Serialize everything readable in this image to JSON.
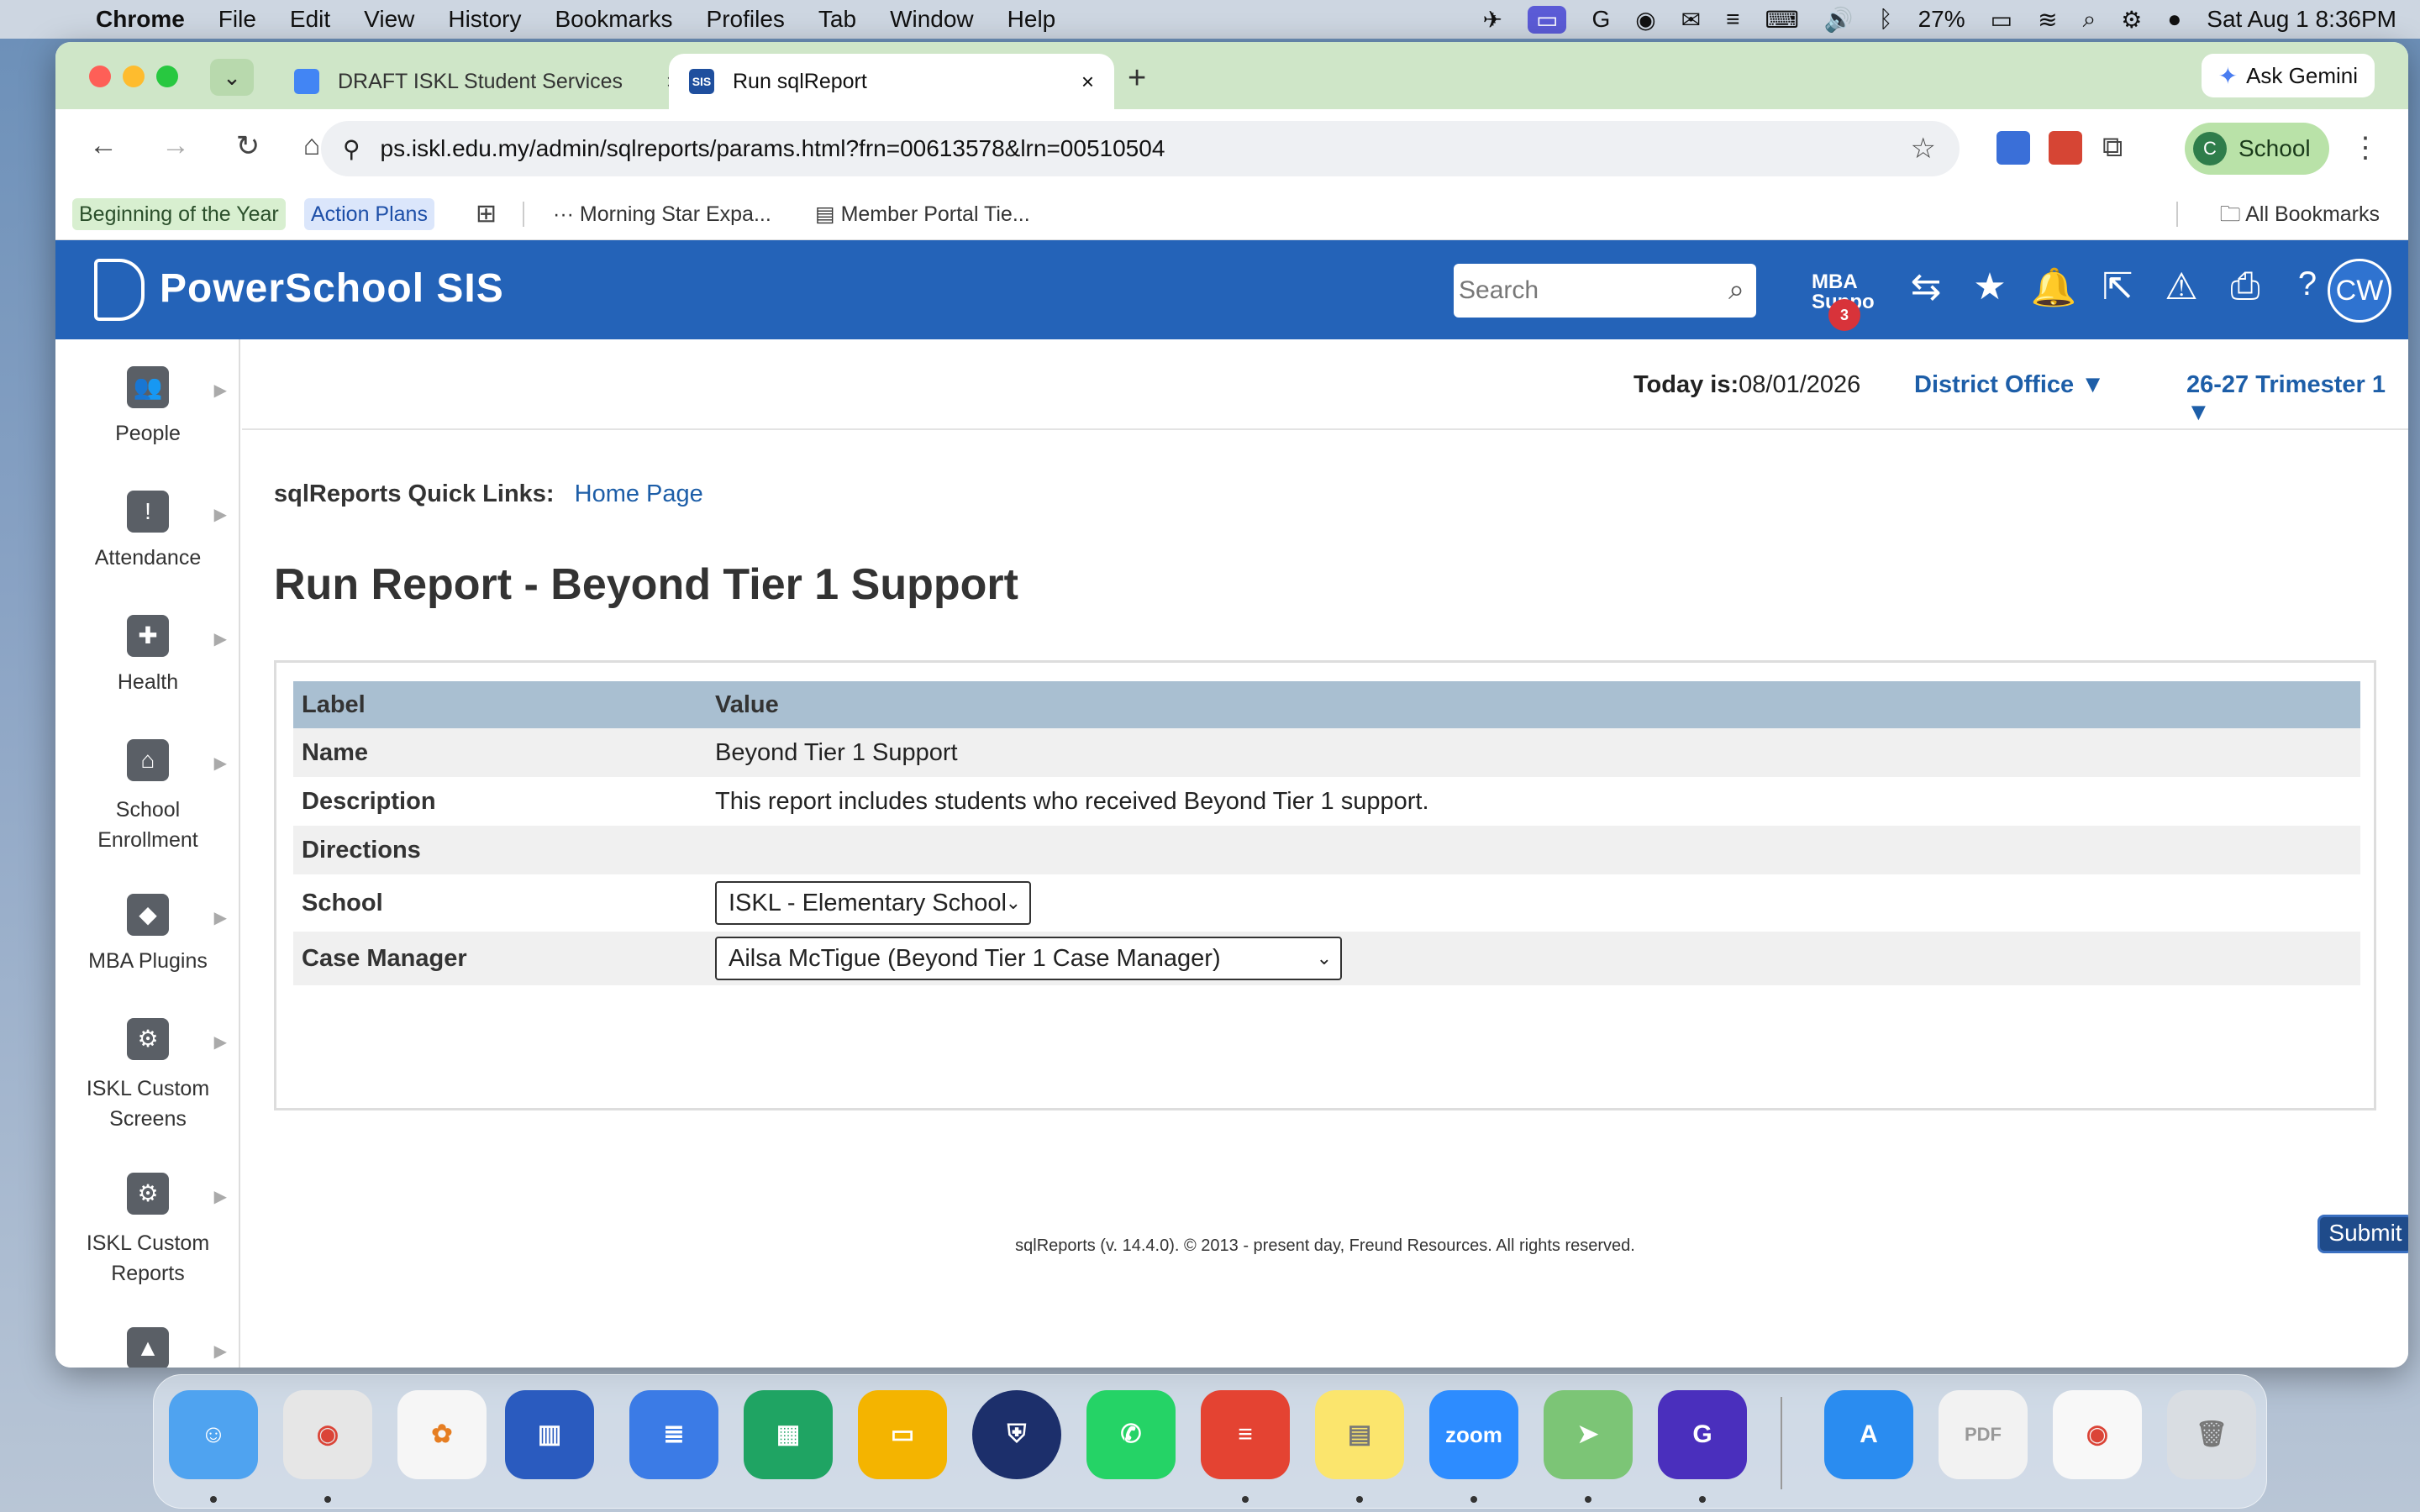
{
  "menubar": {
    "app_name": "Chrome",
    "items": [
      "File",
      "Edit",
      "View",
      "History",
      "Bookmarks",
      "Profiles",
      "Tab",
      "Window",
      "Help"
    ],
    "battery": "27%",
    "datetime": "Sat Aug 1  8:36PM"
  },
  "browser": {
    "tabs": [
      {
        "title": "DRAFT ISKL Student Services",
        "active": false
      },
      {
        "title": "Run sqlReport",
        "active": true
      }
    ],
    "ask_gemini": "Ask Gemini",
    "url": "ps.iskl.edu.my/admin/sqlreports/params.html?frn=00613578&lrn=00510504",
    "profile": "School",
    "profile_initial": "C",
    "bookmarks": [
      "Beginning of the Year",
      "Action Plans",
      "Morning Star Expa...",
      "Member Portal Tie..."
    ],
    "all_bookmarks": "All Bookmarks"
  },
  "ps": {
    "brand": "PowerSchool SIS",
    "search_placeholder": "Search",
    "mba_label": "MBA",
    "mba_sub": "Suppo",
    "mba_count": "3",
    "avatar": "CW",
    "today_label": "Today is:",
    "today_value": "08/01/2026",
    "school_menu": "District Office",
    "term_menu": "26-27 Trimester 1",
    "sidebar": [
      {
        "label": "People",
        "icon": "people-icon"
      },
      {
        "label": "Attendance",
        "icon": "attendance-icon"
      },
      {
        "label": "Health",
        "icon": "health-icon"
      },
      {
        "label": "School Enrollment",
        "icon": "school-enrollment-icon"
      },
      {
        "label": "MBA Plugins",
        "icon": "mba-plugins-icon"
      },
      {
        "label": "ISKL Custom Screens",
        "icon": "custom-screens-icon"
      },
      {
        "label": "ISKL Custom Reports",
        "icon": "custom-reports-icon"
      }
    ]
  },
  "page": {
    "quick_links_label": "sqlReports Quick Links:",
    "home_link": "Home Page",
    "title": "Run Report - Beyond Tier 1 Support",
    "table_header": {
      "label": "Label",
      "value": "Value"
    },
    "rows": {
      "name_label": "Name",
      "name_value": "Beyond Tier 1 Support",
      "description_label": "Description",
      "description_value": "This report includes students who received Beyond Tier 1 support.",
      "directions_label": "Directions",
      "school_label": "School",
      "school_value": "ISKL - Elementary School",
      "case_manager_label": "Case Manager",
      "case_manager_value": "Ailsa McTigue (Beyond Tier 1 Case Manager)"
    },
    "submit": "Submit",
    "footer": "sqlReports (v. 14.4.0). © 2013 - present day, Freund Resources. All rights reserved."
  },
  "dock": {
    "apps": [
      "Finder",
      "Chrome",
      "Photos",
      "Keynote",
      "Google Docs",
      "Google Sheets",
      "Google Slides",
      "ISKL",
      "WhatsApp",
      "Todoist",
      "Notes",
      "zoom",
      "Maps",
      "Grammarly",
      "App Store",
      "PDF",
      "Chrome Window",
      "Trash"
    ]
  },
  "colors": {
    "ps_blue": "#2463b8",
    "table_header": "#a9bfd1",
    "link": "#1d5ea8",
    "tab_strip": "#cfe6c8"
  }
}
